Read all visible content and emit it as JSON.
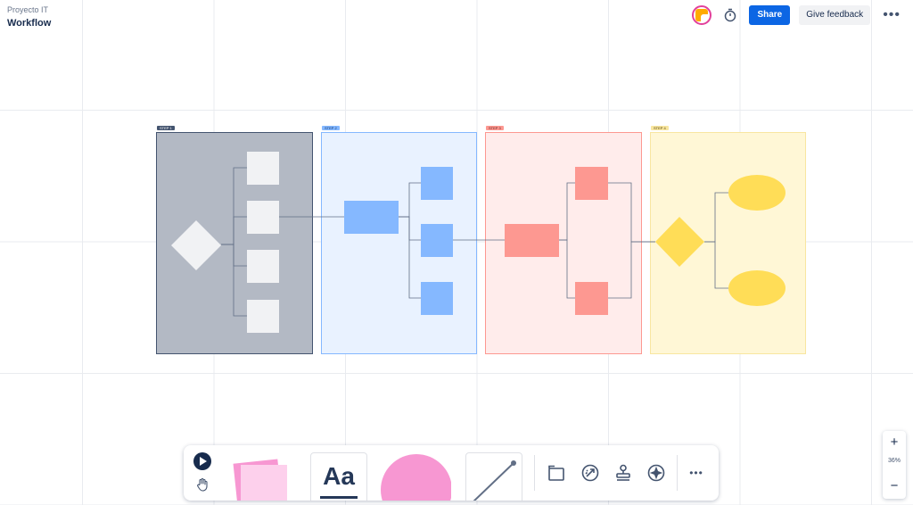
{
  "header": {
    "project": "Proyecto IT",
    "board": "Workflow",
    "share_label": "Share",
    "feedback_label": "Give feedback",
    "more_label": "•••",
    "avatar_icon": "app-logo-avatar",
    "timer_icon": "timer-icon"
  },
  "steps": [
    {
      "label": "STEP 1",
      "fill": "#b3b9c4",
      "border": "#44546f",
      "label_bg": "#44546f",
      "label_color": "#ffffff"
    },
    {
      "label": "STEP 2",
      "fill": "#e9f2ff",
      "border": "#85b8ff",
      "label_bg": "#85b8ff",
      "label_color": "#09326c"
    },
    {
      "label": "STEP 3",
      "fill": "#ffeceb",
      "border": "#fd9891",
      "label_bg": "#fd9891",
      "label_color": "#5d1f1a"
    },
    {
      "label": "STEP 4",
      "fill": "#fff7d6",
      "border": "#f8e6a0",
      "label_bg": "#f8e6a0",
      "label_color": "#533f04"
    }
  ],
  "shape_colors": {
    "gray": "#f1f2f4",
    "blue": "#85b8ff",
    "red": "#fd9891",
    "yellow": "#ffdd57",
    "connector": "#626f86"
  },
  "toolbar": {
    "select_icon": "pointer-icon",
    "hand_icon": "hand-icon",
    "sticky_icon": "sticky-note-icon",
    "text_label": "Aa",
    "shape_icon": "circle-shape-icon",
    "line_icon": "connector-line-icon",
    "frame_icon": "frame-icon",
    "draw_icon": "magic-draw-icon",
    "stamp_icon": "stamp-icon",
    "ai_icon": "sparkle-star-icon",
    "more_label": "•••"
  },
  "zoom": {
    "in_label": "+",
    "level": "36%",
    "out_label": "−"
  }
}
